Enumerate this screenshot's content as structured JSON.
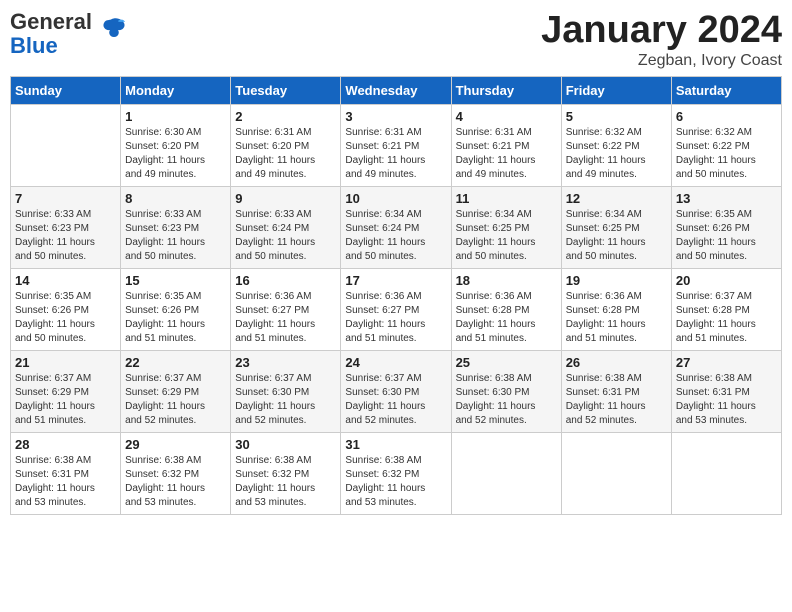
{
  "header": {
    "logo_general": "General",
    "logo_blue": "Blue",
    "month": "January 2024",
    "location": "Zegban, Ivory Coast"
  },
  "days_of_week": [
    "Sunday",
    "Monday",
    "Tuesday",
    "Wednesday",
    "Thursday",
    "Friday",
    "Saturday"
  ],
  "weeks": [
    [
      {
        "day": "",
        "info": ""
      },
      {
        "day": "1",
        "info": "Sunrise: 6:30 AM\nSunset: 6:20 PM\nDaylight: 11 hours\nand 49 minutes."
      },
      {
        "day": "2",
        "info": "Sunrise: 6:31 AM\nSunset: 6:20 PM\nDaylight: 11 hours\nand 49 minutes."
      },
      {
        "day": "3",
        "info": "Sunrise: 6:31 AM\nSunset: 6:21 PM\nDaylight: 11 hours\nand 49 minutes."
      },
      {
        "day": "4",
        "info": "Sunrise: 6:31 AM\nSunset: 6:21 PM\nDaylight: 11 hours\nand 49 minutes."
      },
      {
        "day": "5",
        "info": "Sunrise: 6:32 AM\nSunset: 6:22 PM\nDaylight: 11 hours\nand 49 minutes."
      },
      {
        "day": "6",
        "info": "Sunrise: 6:32 AM\nSunset: 6:22 PM\nDaylight: 11 hours\nand 50 minutes."
      }
    ],
    [
      {
        "day": "7",
        "info": "Sunrise: 6:33 AM\nSunset: 6:23 PM\nDaylight: 11 hours\nand 50 minutes."
      },
      {
        "day": "8",
        "info": "Sunrise: 6:33 AM\nSunset: 6:23 PM\nDaylight: 11 hours\nand 50 minutes."
      },
      {
        "day": "9",
        "info": "Sunrise: 6:33 AM\nSunset: 6:24 PM\nDaylight: 11 hours\nand 50 minutes."
      },
      {
        "day": "10",
        "info": "Sunrise: 6:34 AM\nSunset: 6:24 PM\nDaylight: 11 hours\nand 50 minutes."
      },
      {
        "day": "11",
        "info": "Sunrise: 6:34 AM\nSunset: 6:25 PM\nDaylight: 11 hours\nand 50 minutes."
      },
      {
        "day": "12",
        "info": "Sunrise: 6:34 AM\nSunset: 6:25 PM\nDaylight: 11 hours\nand 50 minutes."
      },
      {
        "day": "13",
        "info": "Sunrise: 6:35 AM\nSunset: 6:26 PM\nDaylight: 11 hours\nand 50 minutes."
      }
    ],
    [
      {
        "day": "14",
        "info": "Sunrise: 6:35 AM\nSunset: 6:26 PM\nDaylight: 11 hours\nand 50 minutes."
      },
      {
        "day": "15",
        "info": "Sunrise: 6:35 AM\nSunset: 6:26 PM\nDaylight: 11 hours\nand 51 minutes."
      },
      {
        "day": "16",
        "info": "Sunrise: 6:36 AM\nSunset: 6:27 PM\nDaylight: 11 hours\nand 51 minutes."
      },
      {
        "day": "17",
        "info": "Sunrise: 6:36 AM\nSunset: 6:27 PM\nDaylight: 11 hours\nand 51 minutes."
      },
      {
        "day": "18",
        "info": "Sunrise: 6:36 AM\nSunset: 6:28 PM\nDaylight: 11 hours\nand 51 minutes."
      },
      {
        "day": "19",
        "info": "Sunrise: 6:36 AM\nSunset: 6:28 PM\nDaylight: 11 hours\nand 51 minutes."
      },
      {
        "day": "20",
        "info": "Sunrise: 6:37 AM\nSunset: 6:28 PM\nDaylight: 11 hours\nand 51 minutes."
      }
    ],
    [
      {
        "day": "21",
        "info": "Sunrise: 6:37 AM\nSunset: 6:29 PM\nDaylight: 11 hours\nand 51 minutes."
      },
      {
        "day": "22",
        "info": "Sunrise: 6:37 AM\nSunset: 6:29 PM\nDaylight: 11 hours\nand 52 minutes."
      },
      {
        "day": "23",
        "info": "Sunrise: 6:37 AM\nSunset: 6:30 PM\nDaylight: 11 hours\nand 52 minutes."
      },
      {
        "day": "24",
        "info": "Sunrise: 6:37 AM\nSunset: 6:30 PM\nDaylight: 11 hours\nand 52 minutes."
      },
      {
        "day": "25",
        "info": "Sunrise: 6:38 AM\nSunset: 6:30 PM\nDaylight: 11 hours\nand 52 minutes."
      },
      {
        "day": "26",
        "info": "Sunrise: 6:38 AM\nSunset: 6:31 PM\nDaylight: 11 hours\nand 52 minutes."
      },
      {
        "day": "27",
        "info": "Sunrise: 6:38 AM\nSunset: 6:31 PM\nDaylight: 11 hours\nand 53 minutes."
      }
    ],
    [
      {
        "day": "28",
        "info": "Sunrise: 6:38 AM\nSunset: 6:31 PM\nDaylight: 11 hours\nand 53 minutes."
      },
      {
        "day": "29",
        "info": "Sunrise: 6:38 AM\nSunset: 6:32 PM\nDaylight: 11 hours\nand 53 minutes."
      },
      {
        "day": "30",
        "info": "Sunrise: 6:38 AM\nSunset: 6:32 PM\nDaylight: 11 hours\nand 53 minutes."
      },
      {
        "day": "31",
        "info": "Sunrise: 6:38 AM\nSunset: 6:32 PM\nDaylight: 11 hours\nand 53 minutes."
      },
      {
        "day": "",
        "info": ""
      },
      {
        "day": "",
        "info": ""
      },
      {
        "day": "",
        "info": ""
      }
    ]
  ]
}
